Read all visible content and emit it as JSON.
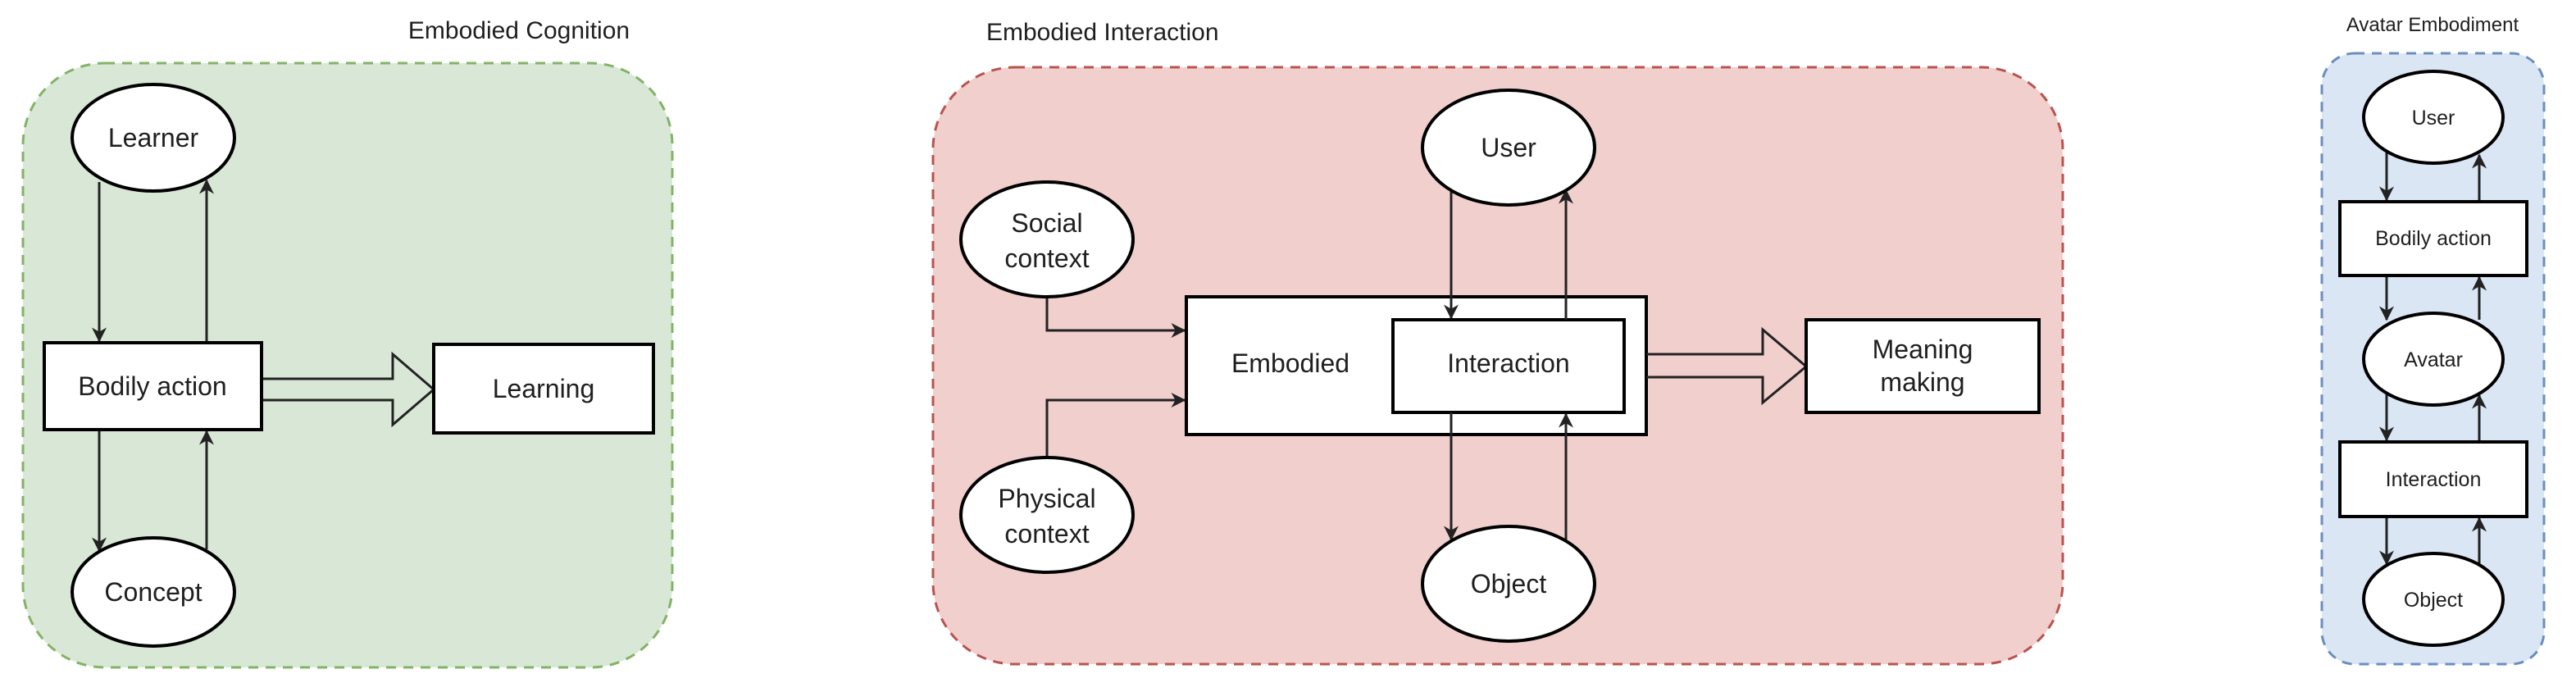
{
  "panels": {
    "cognition": {
      "title": "Embodied Cognition",
      "color": {
        "fill": "#d9e8d6",
        "stroke": "#82b366"
      },
      "nodes": {
        "learner": "Learner",
        "bodily_action": "Bodily action",
        "concept": "Concept",
        "learning": "Learning"
      },
      "edges": [
        {
          "from": "Learner",
          "to": "Bodily action"
        },
        {
          "from": "Bodily action",
          "to": "Learner"
        },
        {
          "from": "Bodily action",
          "to": "Concept"
        },
        {
          "from": "Concept",
          "to": "Bodily action"
        },
        {
          "from": "Bodily action",
          "to": "Learning",
          "style": "block-arrow"
        }
      ]
    },
    "interaction": {
      "title": "Embodied Interaction",
      "color": {
        "fill": "#f0cfcd",
        "stroke": "#b85450"
      },
      "nodes": {
        "social_context": [
          "Social",
          "context"
        ],
        "physical_context": [
          "Physical",
          "context"
        ],
        "embodied": "Embodied",
        "interaction": "Interaction",
        "user": "User",
        "object": "Object",
        "meaning_making": [
          "Meaning",
          "making"
        ]
      },
      "edges": [
        {
          "from": "Social context",
          "to": "Embodied"
        },
        {
          "from": "Physical context",
          "to": "Embodied"
        },
        {
          "from": "User",
          "to": "Interaction"
        },
        {
          "from": "Interaction",
          "to": "User"
        },
        {
          "from": "Interaction",
          "to": "Object"
        },
        {
          "from": "Object",
          "to": "Interaction"
        },
        {
          "from": "Embodied",
          "to": "Meaning making",
          "style": "block-arrow"
        }
      ]
    },
    "avatar": {
      "title": "Avatar Embodiment",
      "color": {
        "fill": "#dae6f4",
        "stroke": "#6c8ebf"
      },
      "nodes": {
        "user": "User",
        "bodily_action": "Bodily action",
        "avatar": "Avatar",
        "interaction": "Interaction",
        "object": "Object"
      },
      "edges": [
        {
          "from": "User",
          "to": "Bodily action"
        },
        {
          "from": "Bodily action",
          "to": "User"
        },
        {
          "from": "Bodily action",
          "to": "Avatar"
        },
        {
          "from": "Avatar",
          "to": "Bodily action"
        },
        {
          "from": "Avatar",
          "to": "Interaction"
        },
        {
          "from": "Interaction",
          "to": "Avatar"
        },
        {
          "from": "Interaction",
          "to": "Object"
        },
        {
          "from": "Object",
          "to": "Interaction"
        }
      ]
    }
  }
}
